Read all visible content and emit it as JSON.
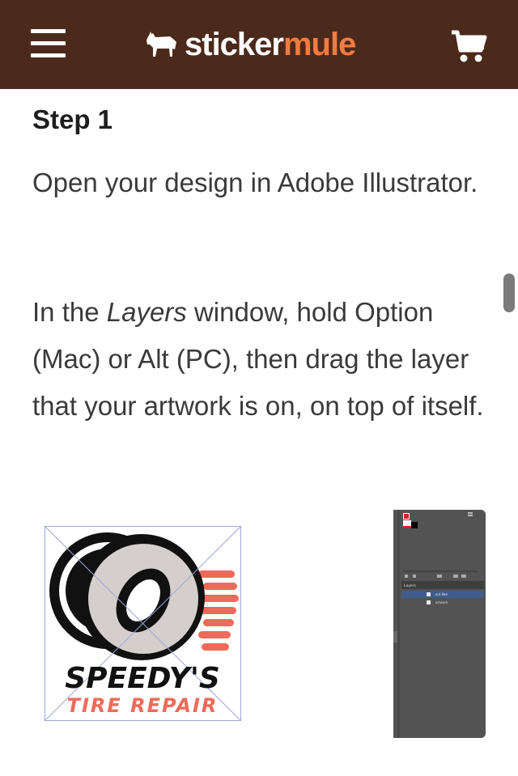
{
  "colors": {
    "header_bg": "#4b2a1c",
    "brand_orange": "#f37b3f",
    "accent_red": "#ee6a5a"
  },
  "header": {
    "menu_icon": "hamburger-menu-icon",
    "logo": {
      "part1": "sticker",
      "part2": "mule",
      "icon": "mule-icon"
    },
    "cart_icon": "shopping-cart-icon"
  },
  "article": {
    "step_title": "Step 1",
    "para1": "Open your design in Adobe Illustrator.",
    "para2_before": "In the ",
    "para2_italic": "Layers",
    "para2_after": " window, hold Option (Mac) or Alt (PC), then drag the layer that your artwork is on, on top of itself."
  },
  "artwork": {
    "line1": "SPEEDY'S",
    "line2": "TIRE REPAIR"
  },
  "layers_panel": {
    "title": "Layers",
    "rows": [
      {
        "name": "cut line"
      },
      {
        "name": "artwork"
      }
    ]
  }
}
